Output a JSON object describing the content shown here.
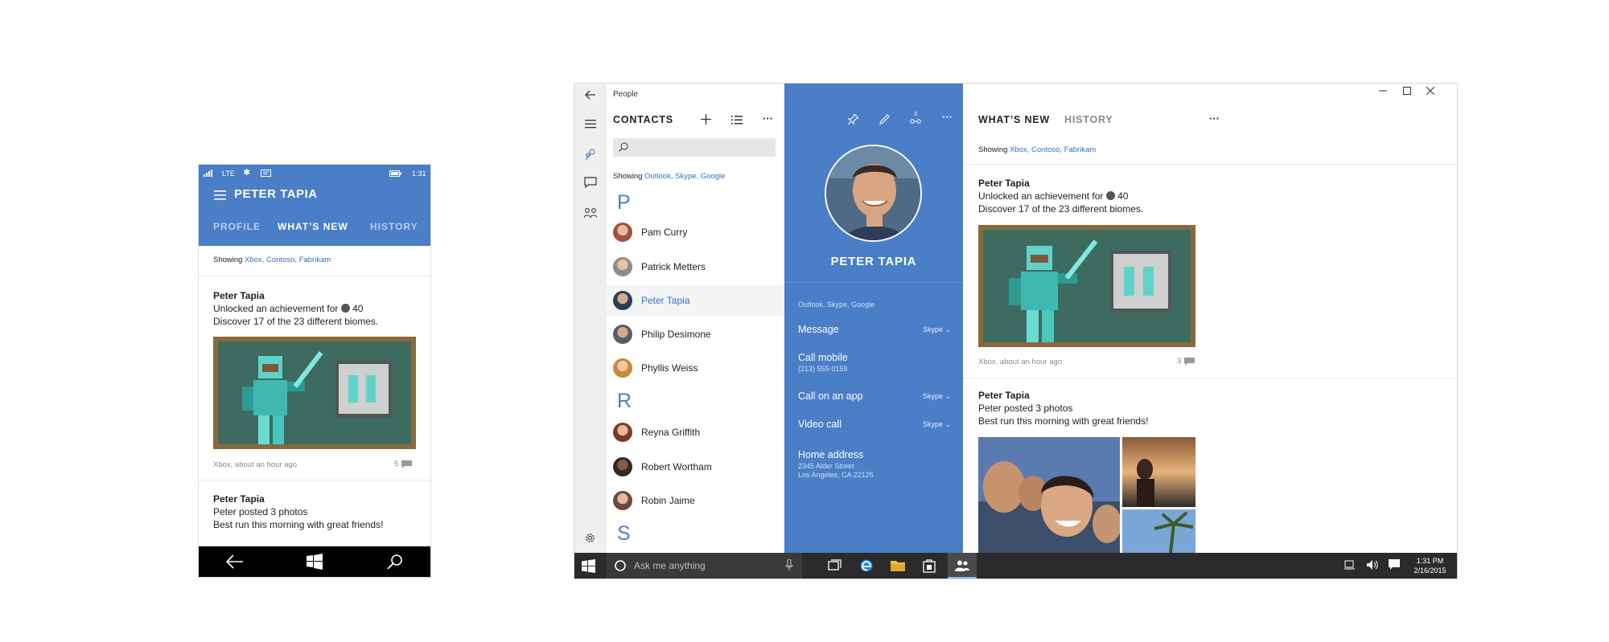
{
  "phone": {
    "status": {
      "network": "LTE",
      "time": "1:31"
    },
    "title": "PETER TAPIA",
    "tabs": [
      "PROFILE",
      "WHAT’S NEW",
      "HISTORY"
    ],
    "showing_label": "Showing",
    "showing_sources": "Xbox, Contoso, Fabrikam",
    "post1": {
      "author": "Peter Tapia",
      "line1": "Unlocked an achievement for",
      "score": "40",
      "line2": "Discover 17 of the 23 different biomes.",
      "meta": "Xbox, about an hour ago",
      "comments": "5"
    },
    "post2": {
      "author": "Peter Tapia",
      "line1": "Peter posted 3 photos",
      "line2": "Best run this morning with great friends!"
    }
  },
  "desktop": {
    "app_title": "People",
    "contacts": {
      "header": "CONTACTS",
      "showing_label": "Showing",
      "showing_sources": "Outlook, Skype, Google",
      "groups": [
        {
          "letter": "P",
          "names": [
            "Pam Curry",
            "Patrick Metters",
            "Peter Tapia",
            "Philip Desimone",
            "Phyllis Weiss"
          ]
        },
        {
          "letter": "R",
          "names": [
            "Reyna Griffith",
            "Robert Wortham",
            "Robin Jaime"
          ]
        },
        {
          "letter": "S",
          "names": []
        }
      ]
    },
    "card": {
      "name": "PETER TAPIA",
      "sources": "Outlook, Skype, Google",
      "actions": [
        {
          "label": "Message",
          "sub": "",
          "app": "Skype"
        },
        {
          "label": "Call mobile",
          "sub": "(213) 555-0159",
          "app": ""
        },
        {
          "label": "Call on an app",
          "sub": "",
          "app": "Skype"
        },
        {
          "label": "Video call",
          "sub": "",
          "app": "Skype"
        },
        {
          "label": "Home address",
          "sub": "2345 Alder Street",
          "sub2": "Los Angeles, CA 22125",
          "app": ""
        }
      ],
      "badge": "3"
    },
    "news": {
      "tabs": [
        "WHAT’S NEW",
        "HISTORY"
      ],
      "showing_label": "Showing",
      "showing_sources": "Xbox, Contoso, Fabrikam",
      "post1": {
        "author": "Peter Tapia",
        "line1": "Unlocked an achievement for",
        "score": "40",
        "line2": "Discover 17 of the 23 different biomes.",
        "meta": "Xbox, about an hour ago",
        "comments": "3"
      },
      "post2": {
        "author": "Peter Tapia",
        "line1": "Peter posted 3 photos",
        "line2": "Best run this morning with great friends!"
      }
    },
    "taskbar": {
      "search_placeholder": "Ask me anything",
      "time": "1:31 PM",
      "date": "2/16/2015"
    }
  },
  "colors": {
    "accent": "#4a7ec7",
    "link": "#2f6fc4"
  }
}
